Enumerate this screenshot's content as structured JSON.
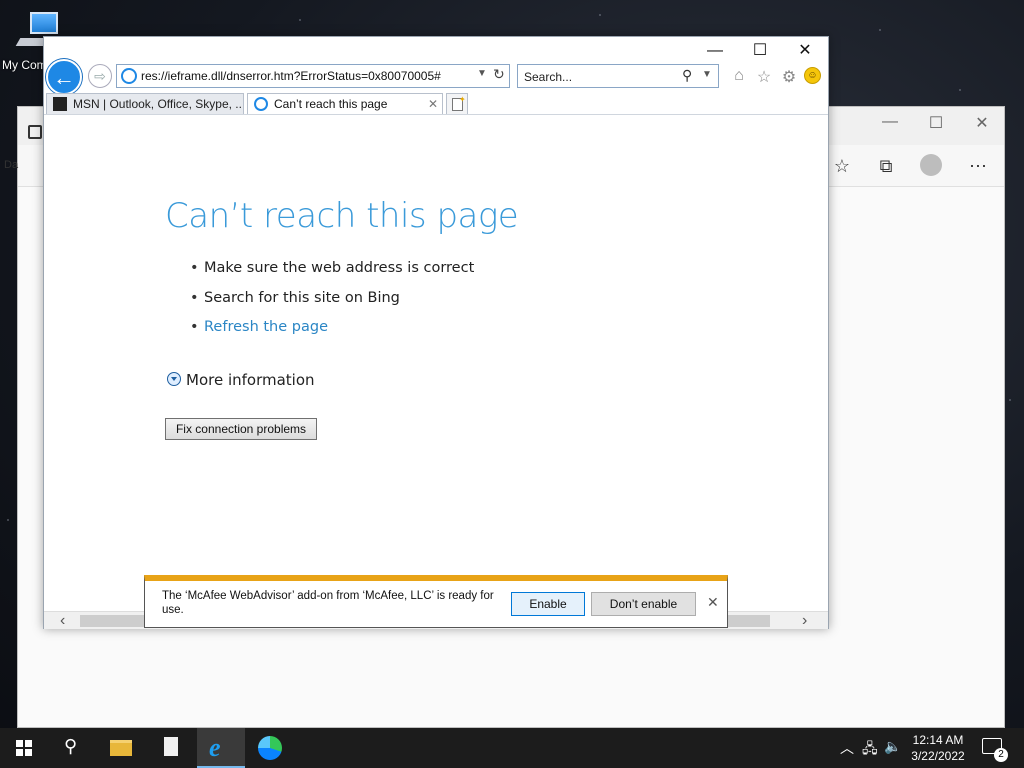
{
  "desktop": {
    "icon_label": "My Com"
  },
  "edge_bg": {
    "partial_label": "Da"
  },
  "ie": {
    "address": "res://ieframe.dll/dnserror.htm?ErrorStatus=0x80070005#",
    "search_placeholder": "Search...",
    "tabs": [
      {
        "label": "MSN | Outlook, Office, Skype, ..."
      },
      {
        "label": "Can’t reach this page"
      }
    ],
    "page": {
      "title": "Can’t reach this page",
      "bullets": [
        "Make sure the web address is correct",
        "Search for this site on Bing",
        "Refresh the page"
      ],
      "more_info": "More information",
      "fix_button": "Fix connection problems"
    },
    "notification": {
      "text": "The ‘McAfee WebAdvisor’ add-on from ‘McAfee, LLC’ is ready for use.",
      "enable": "Enable",
      "dont_enable": "Don’t enable"
    }
  },
  "taskbar": {
    "time": "12:14 AM",
    "date": "3/22/2022",
    "notification_count": "2"
  },
  "colors": {
    "title_blue": "#3a9ad9",
    "link_blue": "#2b86c5",
    "notif_bar": "#e8a317",
    "taskbar": "#1c1c1c"
  }
}
